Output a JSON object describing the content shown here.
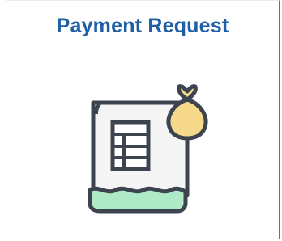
{
  "tile": {
    "title": "Payment Request",
    "icon": "payment-request-icon",
    "colors": {
      "title": "#1f5fa6",
      "outline": "#3d4450",
      "paper": "#f5f5f5",
      "wave": "#aeeac6",
      "money_bag": "#f6d98a",
      "border": "#6f6f6f"
    }
  }
}
